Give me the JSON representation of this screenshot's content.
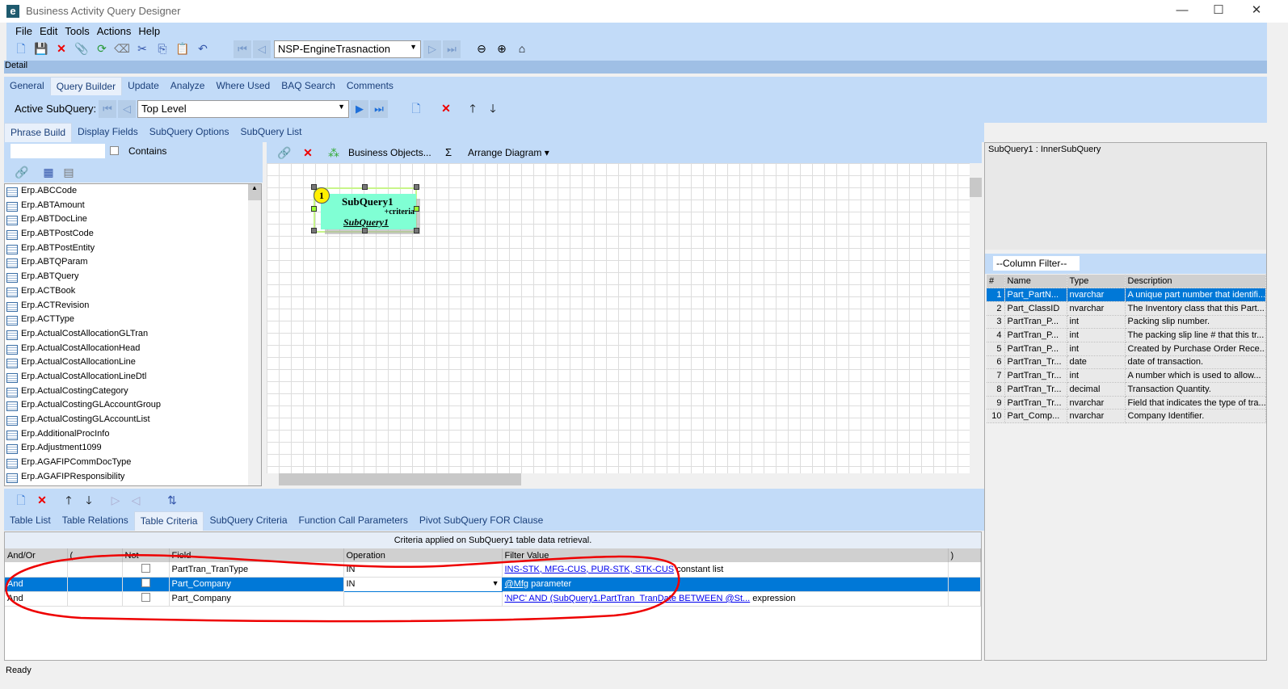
{
  "window": {
    "title": "Business Activity Query Designer",
    "controls": [
      "—",
      "☐",
      "✕"
    ]
  },
  "menu": [
    "File",
    "Edit",
    "Tools",
    "Actions",
    "Help"
  ],
  "toolbar": {
    "query_id": "NSP-EngineTrasnaction"
  },
  "detail_label": "Detail",
  "main_tabs": [
    {
      "label": "General"
    },
    {
      "label": "Query Builder",
      "active": true
    },
    {
      "label": "Update"
    },
    {
      "label": "Analyze"
    },
    {
      "label": "Where Used"
    },
    {
      "label": "BAQ Search"
    },
    {
      "label": "Comments"
    }
  ],
  "subquery_bar": {
    "label": "Active SubQuery:",
    "value": "Top Level"
  },
  "sub_tabs": [
    {
      "label": "Phrase Build",
      "active": true
    },
    {
      "label": "Display Fields"
    },
    {
      "label": "SubQuery Options"
    },
    {
      "label": "SubQuery List"
    }
  ],
  "left": {
    "search_value": "",
    "contains_label": "Contains",
    "contains_checked": false,
    "tables": [
      "Erp.ABCCode",
      "Erp.ABTAmount",
      "Erp.ABTDocLine",
      "Erp.ABTPostCode",
      "Erp.ABTPostEntity",
      "Erp.ABTQParam",
      "Erp.ABTQuery",
      "Erp.ACTBook",
      "Erp.ACTRevision",
      "Erp.ACTType",
      "Erp.ActualCostAllocationGLTran",
      "Erp.ActualCostAllocationHead",
      "Erp.ActualCostAllocationLine",
      "Erp.ActualCostAllocationLineDtl",
      "Erp.ActualCostingCategory",
      "Erp.ActualCostingGLAccountGroup",
      "Erp.ActualCostingGLAccountList",
      "Erp.AdditionalProcInfo",
      "Erp.Adjustment1099",
      "Erp.AGAFIPCommDocType",
      "Erp.AGAFIPResponsibility"
    ]
  },
  "diagram_toolbar": {
    "business_objects": "Business Objects...",
    "sigma": "Σ",
    "arrange": "Arrange Diagram"
  },
  "diagram_node": {
    "badge": "1",
    "title": "SubQuery1",
    "criteria": "+criteria",
    "alias": "SubQuery1",
    "color": "#80ffd4"
  },
  "right": {
    "header": "SubQuery1 : InnerSubQuery",
    "column_filter": "--Column Filter--",
    "columns": [
      "#",
      "Name",
      "Type",
      "Description"
    ],
    "rows": [
      [
        "1",
        "Part_PartN...",
        "nvarchar",
        "A unique part number that identifi..."
      ],
      [
        "2",
        "Part_ClassID",
        "nvarchar",
        "The Inventory class that this Part..."
      ],
      [
        "3",
        "PartTran_P...",
        "int",
        "Packing slip number."
      ],
      [
        "4",
        "PartTran_P...",
        "int",
        "The packing slip line # that this tr..."
      ],
      [
        "5",
        "PartTran_P...",
        "int",
        "Created by Purchase Order Rece..."
      ],
      [
        "6",
        "PartTran_Tr...",
        "date",
        "date of transaction."
      ],
      [
        "7",
        "PartTran_Tr...",
        "int",
        "A number which is used to allow..."
      ],
      [
        "8",
        "PartTran_Tr...",
        "decimal",
        "Transaction Quantity."
      ],
      [
        "9",
        "PartTran_Tr...",
        "nvarchar",
        "Field that indicates the type of tra..."
      ],
      [
        "10",
        "Part_Comp...",
        "nvarchar",
        "Company Identifier."
      ]
    ]
  },
  "bottom_tabs": [
    {
      "label": "Table List"
    },
    {
      "label": "Table Relations"
    },
    {
      "label": "Table Criteria",
      "active": true
    },
    {
      "label": "SubQuery Criteria"
    },
    {
      "label": "Function Call Parameters"
    },
    {
      "label": "Pivot SubQuery FOR Clause"
    }
  ],
  "criteria": {
    "caption": "Criteria applied on SubQuery1 table data retrieval.",
    "columns": [
      "And/Or",
      "(",
      "Not",
      "Field",
      "Operation",
      "Filter Value",
      ")"
    ],
    "rows": [
      {
        "andor": "",
        "open": "",
        "not": false,
        "field": "PartTran_TranType",
        "operation": "IN",
        "value_link": "INS-STK, MFG-CUS, PUR-STK, STK-CUS",
        "value_type": "constant list",
        "close": ""
      },
      {
        "andor": "And",
        "open": "",
        "not": false,
        "field": "Part_Company",
        "operation": "IN",
        "value_link": "@Mfg",
        "value_type": "parameter",
        "close": "",
        "selected": true
      },
      {
        "andor": "And",
        "open": "",
        "not": false,
        "field": "Part_Company",
        "operation": "",
        "value_link": "'NPC' AND (SubQuery1.PartTran_TranDate BETWEEN @St...",
        "value_type": "expression",
        "close": ""
      }
    ]
  },
  "status": "Ready"
}
